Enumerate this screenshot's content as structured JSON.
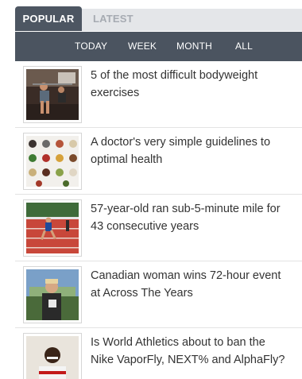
{
  "tabs": {
    "popular": "POPULAR",
    "latest": "LATEST"
  },
  "filters": {
    "today": "TODAY",
    "week": "WEEK",
    "month": "MONTH",
    "all": "ALL"
  },
  "articles": [
    {
      "title_line1": "5 of the most difficult bodyweight",
      "title_line2": "exercises"
    },
    {
      "title_line1": "A doctor's very simple guidelines to",
      "title_line2": "optimal health"
    },
    {
      "title_line1": "57-year-old ran sub-5-minute mile for",
      "title_line2": "43 consecutive years"
    },
    {
      "title_line1": "Canadian woman wins 72-hour event",
      "title_line2": "at Across The Years"
    },
    {
      "title_line1": "Is World Athletics about to ban the",
      "title_line2": "Nike VaporFly, NEXT% and AlphaFly?"
    }
  ],
  "colors": {
    "tab_active_bg": "#4d5662",
    "tab_strip_bg": "#e4e6e9",
    "filter_bar_bg": "#4b5460",
    "title_text": "#333333"
  }
}
